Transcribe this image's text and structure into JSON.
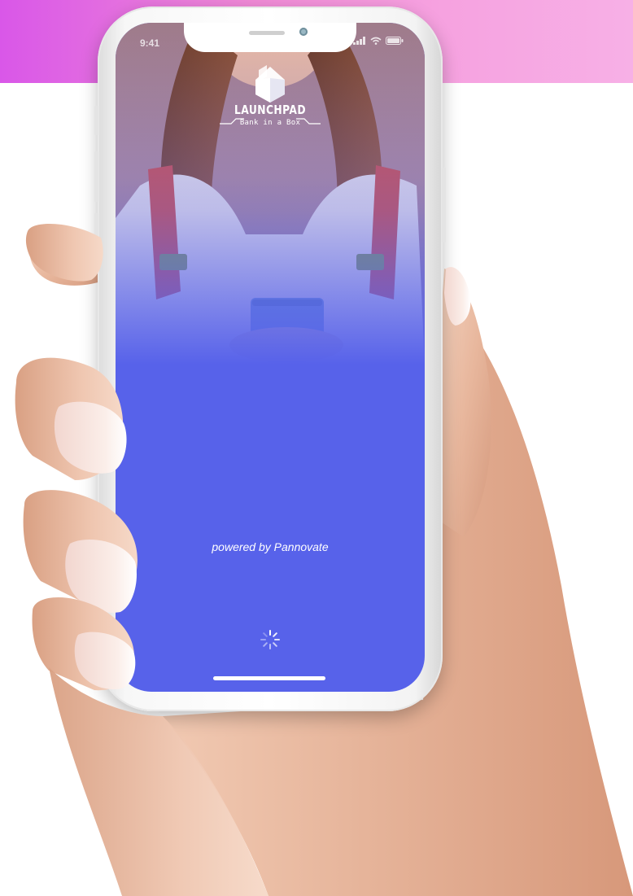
{
  "status_bar": {
    "time": "9:41"
  },
  "app": {
    "logo_title": "LAUNCHPAD",
    "logo_subtitle": "Bank in a Box",
    "powered_by": "powered by Pannovate"
  },
  "icons": {
    "logo": "cube-logo-icon",
    "loading": "loading-spinner-icon",
    "signal": "cellular-signal-icon",
    "wifi": "wifi-icon",
    "battery": "battery-icon"
  },
  "colors": {
    "screen_accent": "#5762ea",
    "banner_gradient_start": "#d957e8",
    "banner_gradient_end": "#f7b0e6"
  }
}
